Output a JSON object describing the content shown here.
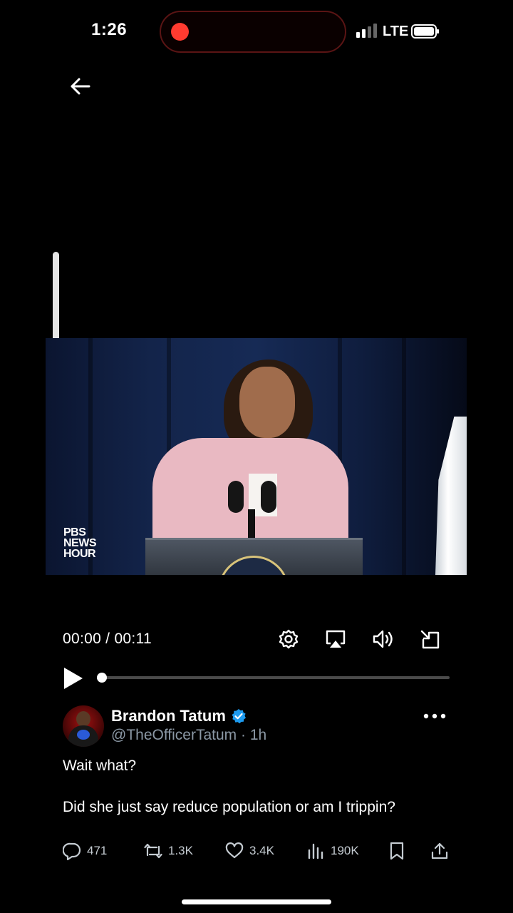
{
  "status_bar": {
    "time": "1:26",
    "network": "LTE",
    "recording_color": "#ff3b30"
  },
  "navigation": {
    "back_icon": "arrow-left-icon"
  },
  "video": {
    "watermark_line1": "PBS",
    "watermark_line2": "NEWS",
    "watermark_line3": "HOUR",
    "current_time": "00:00",
    "duration": "00:11",
    "time_text": "00:00 / 00:11",
    "progress_fraction": 0,
    "controls": [
      "settings-icon",
      "airplay-icon",
      "volume-icon",
      "exit-fullscreen-icon"
    ]
  },
  "tweet": {
    "display_name": "Brandon Tatum",
    "verified": true,
    "handle": "@TheOfficerTatum",
    "separator": "·",
    "age": "1h",
    "handle_line": "@TheOfficerTatum · 1h",
    "text_line1": "Wait what?",
    "text_line2": "Did she just say reduce population or am I trippin?",
    "accent_color": "#1d9bf0"
  },
  "actions": {
    "replies": "471",
    "retweets": "1.3K",
    "likes": "3.4K",
    "views": "190K"
  }
}
